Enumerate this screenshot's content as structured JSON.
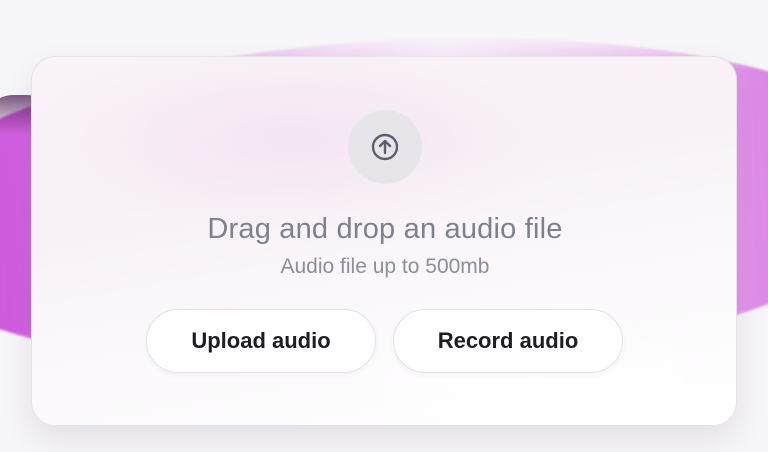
{
  "dropzone": {
    "icon": "upload-arrow-circle-icon",
    "title": "Drag and drop an audio file",
    "subtitle": "Audio file up to 500mb"
  },
  "actions": {
    "upload_label": "Upload audio",
    "record_label": "Record audio"
  },
  "colors": {
    "accent": "#c94fd8",
    "title_text": "#7d8090",
    "button_text": "#1d1e24"
  }
}
